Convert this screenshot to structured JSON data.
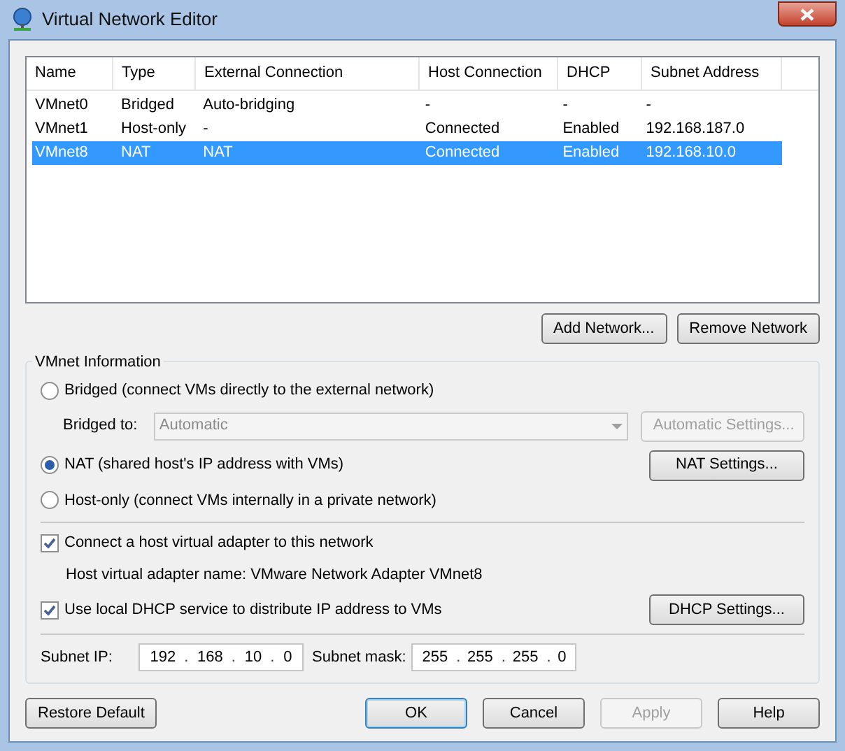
{
  "window": {
    "title": "Virtual Network Editor"
  },
  "table": {
    "columns": [
      "Name",
      "Type",
      "External Connection",
      "Host Connection",
      "DHCP",
      "Subnet Address"
    ],
    "rows": [
      {
        "cells": [
          "VMnet0",
          "Bridged",
          "Auto-bridging",
          "-",
          "-",
          "-"
        ],
        "selected": false
      },
      {
        "cells": [
          "VMnet1",
          "Host-only",
          "-",
          "Connected",
          "Enabled",
          "192.168.187.0"
        ],
        "selected": false
      },
      {
        "cells": [
          "VMnet8",
          "NAT",
          "NAT",
          "Connected",
          "Enabled",
          "192.168.10.0"
        ],
        "selected": true
      }
    ]
  },
  "network_buttons": [
    {
      "label": "Add Network...",
      "disabled": false
    },
    {
      "label": "Remove Network",
      "disabled": false
    }
  ],
  "vmnet_info": {
    "title": "VMnet Information",
    "bridged": {
      "label": "Bridged (connect VMs directly to the external network)",
      "selected": false
    },
    "bridged_to": {
      "label": "Bridged to:",
      "value": "Automatic",
      "disabled": true,
      "button": {
        "label": "Automatic Settings...",
        "disabled": true
      }
    },
    "nat": {
      "label": "NAT (shared host's IP address with VMs)",
      "selected": true,
      "button": {
        "label": "NAT Settings...",
        "disabled": false
      }
    },
    "host_only": {
      "label": "Host-only (connect VMs internally in a private network)",
      "selected": false
    },
    "connect_adapter": {
      "label": "Connect a host virtual adapter to this network",
      "checked": true
    },
    "adapter_name": "Host virtual adapter name: VMware Network Adapter VMnet8",
    "use_dhcp": {
      "label": "Use local DHCP service to distribute IP address to VMs",
      "checked": true,
      "button": {
        "label": "DHCP Settings...",
        "disabled": false
      }
    },
    "subnet_ip": {
      "label": "Subnet IP:",
      "octets": [
        "192",
        "168",
        "10",
        "0"
      ],
      "separator": "."
    },
    "subnet_mask": {
      "label": "Subnet mask:",
      "octets": [
        "255",
        "255",
        "255",
        "0"
      ],
      "separator": "."
    }
  },
  "footer_buttons": [
    {
      "label": "Restore Default",
      "disabled": false,
      "default": false
    },
    {
      "label": "OK",
      "disabled": false,
      "default": true
    },
    {
      "label": "Cancel",
      "disabled": false,
      "default": false
    },
    {
      "label": "Apply",
      "disabled": true,
      "default": false
    },
    {
      "label": "Help",
      "disabled": false,
      "default": false
    }
  ]
}
